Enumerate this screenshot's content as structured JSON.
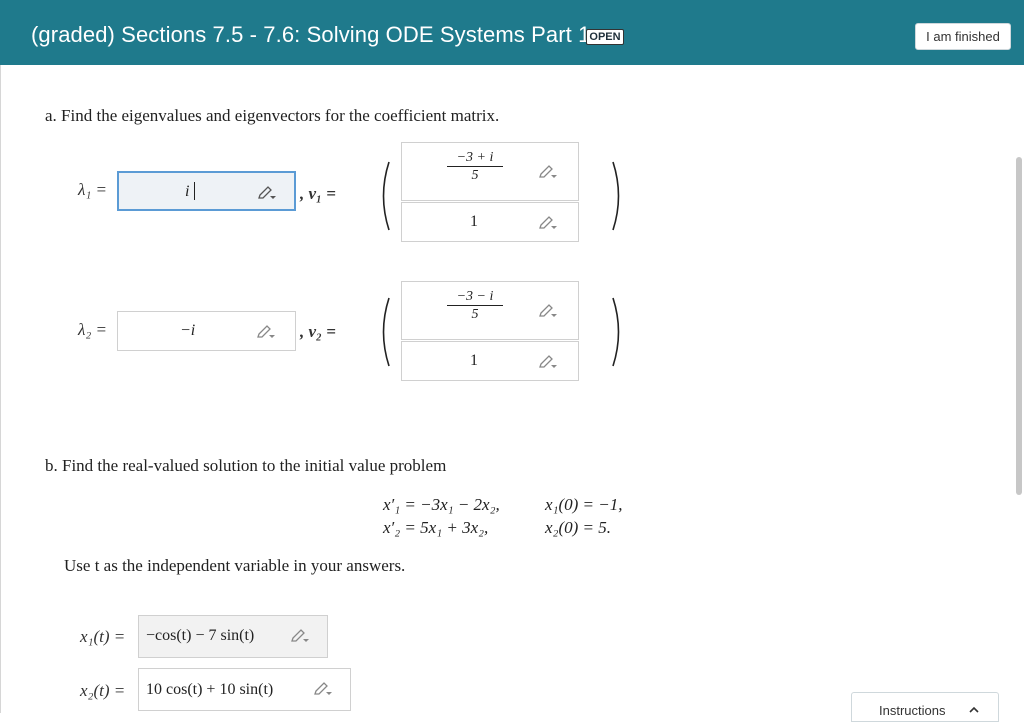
{
  "header": {
    "title": "(graded) Sections 7.5 - 7.6: Solving ODE Systems Part 1",
    "badge": "OPEN",
    "finish_button": "I am finished"
  },
  "part_a": {
    "prompt": "a. Find the eigenvalues and eigenvectors for the coefficient matrix.",
    "lambda1": {
      "label": "λ₁ =",
      "value": "i"
    },
    "v1": {
      "label": ", v₁ =",
      "top": {
        "numerator": "−3 + i",
        "denominator": "5"
      },
      "bottom": "1"
    },
    "lambda2": {
      "label": "λ₂ =",
      "value": "−i"
    },
    "v2": {
      "label": ", v₂ =",
      "top": {
        "numerator": "−3 − i",
        "denominator": "5"
      },
      "bottom": "1"
    }
  },
  "part_b": {
    "prompt": "b. Find the real-valued solution to the initial value problem",
    "eq1": "x′₁ = −3x₁ − 2x₂,",
    "eq2": "x′₂ = 5x₁ + 3x₂,",
    "ic1": "x₁(0) = −1,",
    "ic2": "x₂(0) = 5.",
    "instruction": "Use t as the independent variable in your answers.",
    "x1": {
      "label": "x₁(t) =",
      "value": "−cos(t) − 7 sin(t)"
    },
    "x2": {
      "label": "x₂(t) =",
      "value": "10 cos(t) + 10 sin(t)"
    }
  },
  "footer": {
    "instructions_tab": "Instructions"
  }
}
